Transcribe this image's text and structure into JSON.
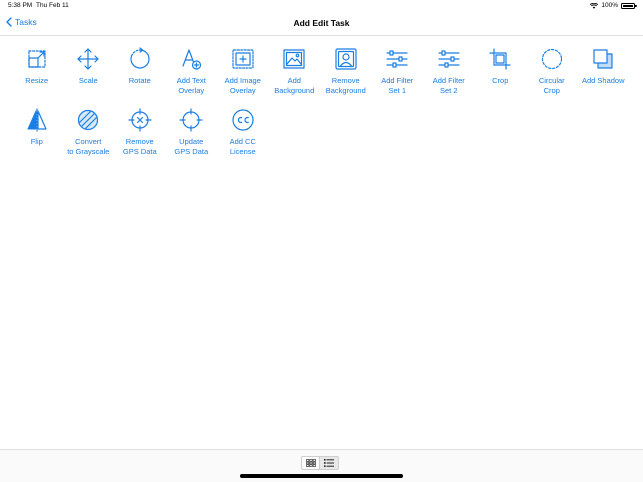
{
  "status_bar": {
    "time": "5:38 PM",
    "date": "Thu Feb 11",
    "battery": "100%"
  },
  "nav": {
    "back_label": "Tasks",
    "title": "Add Edit Task"
  },
  "accent_color": "#1a7ee3",
  "tasks": [
    {
      "label": "Resize",
      "icon": "resize-icon"
    },
    {
      "label": "Scale",
      "icon": "scale-icon"
    },
    {
      "label": "Rotate",
      "icon": "rotate-icon"
    },
    {
      "label": "Add Text\nOverlay",
      "icon": "text-overlay-icon"
    },
    {
      "label": "Add Image\nOverlay",
      "icon": "image-overlay-icon"
    },
    {
      "label": "Add\nBackground",
      "icon": "background-icon"
    },
    {
      "label": "Remove\nBackground",
      "icon": "remove-background-icon"
    },
    {
      "label": "Add Filter\nSet 1",
      "icon": "filter-sliders-icon"
    },
    {
      "label": "Add Filter\nSet 2",
      "icon": "filter-sliders-icon"
    },
    {
      "label": "Crop",
      "icon": "crop-icon"
    },
    {
      "label": "Circular\nCrop",
      "icon": "circular-crop-icon"
    },
    {
      "label": "Add Shadow",
      "icon": "shadow-icon"
    },
    {
      "label": "Flip",
      "icon": "flip-icon"
    },
    {
      "label": "Convert\nto Grayscale",
      "icon": "grayscale-icon"
    },
    {
      "label": "Remove\nGPS Data",
      "icon": "remove-gps-icon"
    },
    {
      "label": "Update\nGPS Data",
      "icon": "update-gps-icon"
    },
    {
      "label": "Add CC\nLicense",
      "icon": "cc-license-icon"
    }
  ],
  "view_toggle": {
    "selected": "list"
  }
}
